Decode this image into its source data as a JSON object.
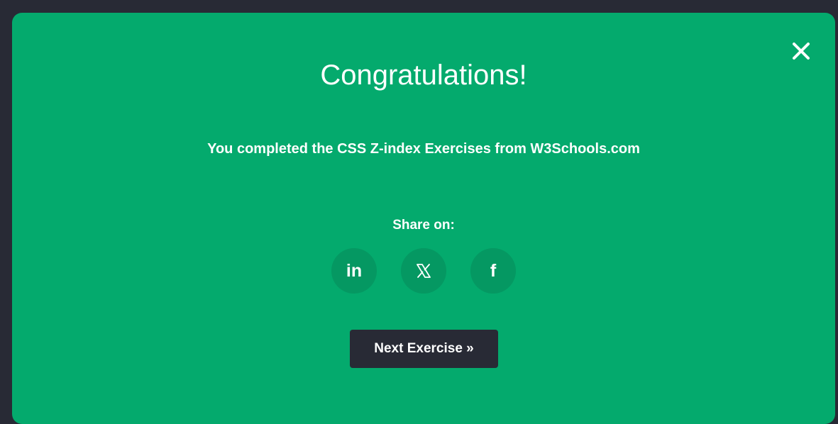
{
  "modal": {
    "title": "Congratulations!",
    "message": "You completed the CSS Z-index Exercises from W3Schools.com",
    "close_icon": "close-icon",
    "share": {
      "label": "Share on:",
      "items": [
        {
          "name": "linkedin",
          "glyph": "in",
          "icon": "linkedin-icon"
        },
        {
          "name": "x",
          "glyph": "X",
          "icon": "x-icon"
        },
        {
          "name": "facebook",
          "glyph": "f",
          "icon": "facebook-icon"
        }
      ]
    },
    "next_button": "Next Exercise »"
  },
  "colors": {
    "background": "#282a35",
    "modal": "#04aa6d",
    "share_circle": "#059862",
    "button": "#282a35",
    "text": "#ffffff"
  }
}
